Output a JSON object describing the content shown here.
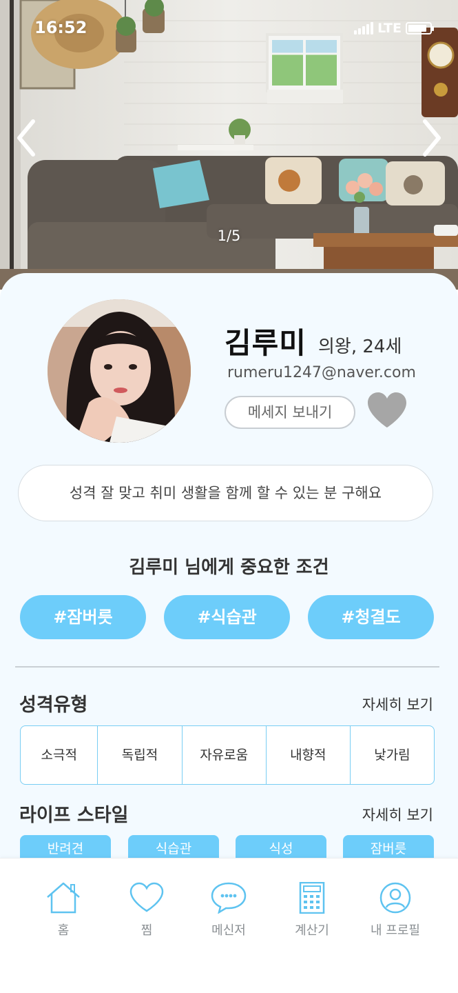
{
  "status_bar": {
    "time": "16:52",
    "network": "LTE"
  },
  "gallery": {
    "counter": "1/5"
  },
  "profile": {
    "name": "김루미",
    "meta": "의왕, 24세",
    "email": "rumeru1247@naver.com",
    "message_button": "메세지 보내기",
    "intro": "성격 잘 맞고 취미 생활을 함께 할 수 있는 분 구해요"
  },
  "conditions": {
    "title": "김루미 님에게 중요한 조건",
    "tags": [
      "#잠버릇",
      "#식습관",
      "#청결도"
    ]
  },
  "personality": {
    "title": "성격유형",
    "more": "자세히 보기",
    "traits": [
      "소극적",
      "독립적",
      "자유로움",
      "내향적",
      "낯가림"
    ]
  },
  "lifestyle": {
    "title": "라이프 스타일",
    "more": "자세히 보기",
    "tags": [
      "반려견",
      "식습관",
      "식성",
      "잠버릇"
    ]
  },
  "bottom_nav": {
    "items": [
      {
        "label": "홈",
        "icon": "home-icon"
      },
      {
        "label": "찜",
        "icon": "heart-icon"
      },
      {
        "label": "메신저",
        "icon": "chat-bubble-icon"
      },
      {
        "label": "계산기",
        "icon": "calculator-icon"
      },
      {
        "label": "내 프로필",
        "icon": "user-icon"
      }
    ]
  },
  "colors": {
    "accent": "#6dcdfa",
    "card_background": "#f3faff",
    "heart_gray": "#a6a6a6",
    "nav_icon": "#5ec3f0"
  }
}
